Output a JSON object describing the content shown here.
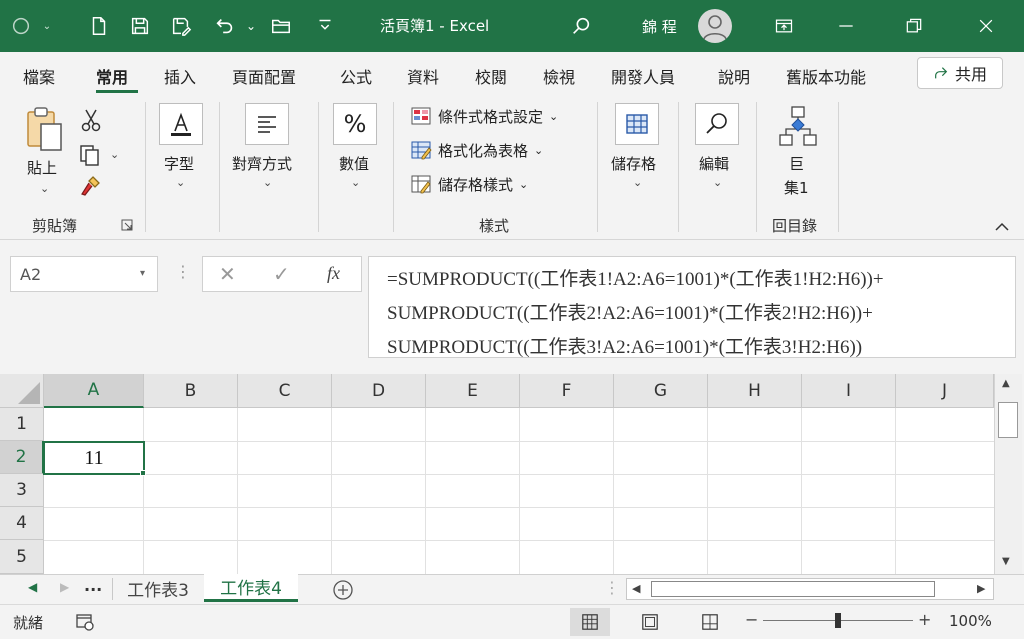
{
  "titlebar": {
    "title": "活頁簿1  -  Excel",
    "user": "錦 程"
  },
  "tabs": [
    "檔案",
    "常用",
    "插入",
    "頁面配置",
    "公式",
    "資料",
    "校閱",
    "檢視",
    "開發人員",
    "說明",
    "舊版本功能"
  ],
  "share_label": "共用",
  "ribbon": {
    "paste_label": "貼上",
    "clipboard_group": "剪貼簿",
    "font_label": "字型",
    "alignment_label": "對齊方式",
    "number_label": "數值",
    "cond_format": "條件式格式設定",
    "format_table": "格式化為表格",
    "cell_styles": "儲存格樣式",
    "styles_group": "樣式",
    "cells_label": "儲存格",
    "editing_label": "編輯",
    "macro_label_1": "巨",
    "macro_label_2": "集1",
    "macro_group": "回目錄"
  },
  "formula_bar": {
    "namebox": "A2",
    "fx": "fx",
    "formula_lines": [
      "=SUMPRODUCT((工作表1!A2:A6=1001)*(工作表1!H2:H6))+",
      "SUMPRODUCT((工作表2!A2:A6=1001)*(工作表2!H2:H6))+",
      "SUMPRODUCT((工作表3!A2:A6=1001)*(工作表3!H2:H6))"
    ]
  },
  "grid": {
    "columns": [
      "A",
      "B",
      "C",
      "D",
      "E",
      "F",
      "G",
      "H",
      "I",
      "J"
    ],
    "rows": [
      "1",
      "2",
      "3",
      "4",
      "5"
    ],
    "active_cell_value": "11"
  },
  "sheets": {
    "ellipsis": "...",
    "tabs": [
      "工作表3",
      "工作表4"
    ],
    "active": "工作表4"
  },
  "status": {
    "ready": "就緒",
    "zoom": "100%",
    "zoom_minus": "−",
    "zoom_plus": "+"
  },
  "colors": {
    "brand": "#217346"
  }
}
